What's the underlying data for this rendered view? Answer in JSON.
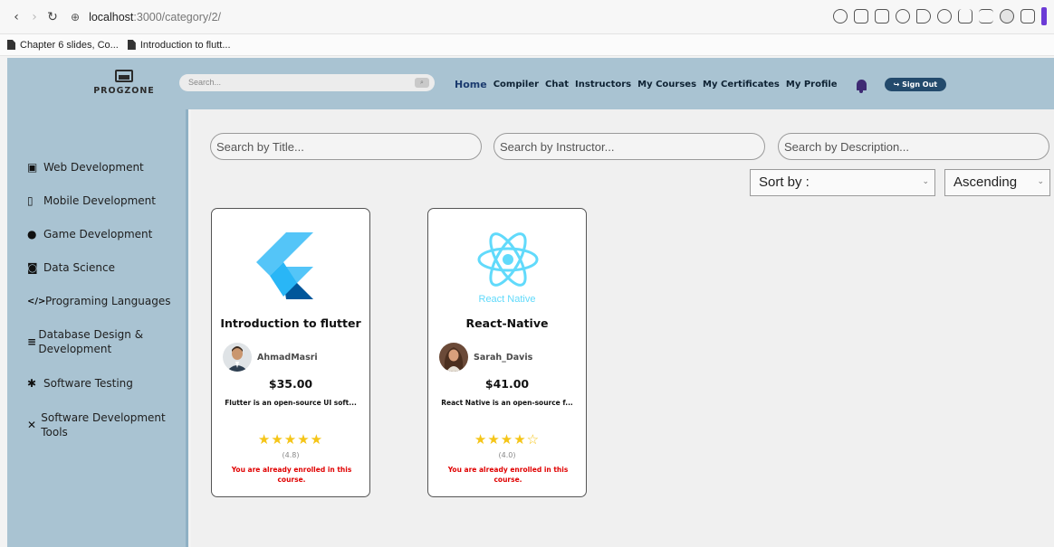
{
  "browser": {
    "url_host": "localhost",
    "url_path": ":3000/category/2/",
    "bookmarks": [
      "Chapter 6 slides, Co...",
      "Introduction to flutt..."
    ]
  },
  "header": {
    "logo_text": "PROGZONE",
    "search_placeholder": "Search...",
    "nav": [
      "Home",
      "Compiler",
      "Chat",
      "Instructors",
      "My Courses",
      "My Certificates",
      "My Profile"
    ],
    "sign_out": "Sign Out",
    "bell_icon": "bell-icon"
  },
  "sidebar": {
    "categories": [
      {
        "label": "Web Development",
        "icon": "laptop-icon"
      },
      {
        "label": "Mobile Development",
        "icon": "phone-icon"
      },
      {
        "label": "Game Development",
        "icon": "gamepad-icon"
      },
      {
        "label": "Data Science",
        "icon": "robot-icon"
      },
      {
        "label": "Programing Languages",
        "icon": "code-icon"
      },
      {
        "label": "Database Design & Development",
        "icon": "database-icon"
      },
      {
        "label": "Software Testing",
        "icon": "bug-icon"
      },
      {
        "label": "Software Development Tools",
        "icon": "tools-icon"
      }
    ]
  },
  "filters": {
    "title_placeholder": "Search by Title...",
    "instructor_placeholder": "Search by Instructor...",
    "description_placeholder": "Search by Description...",
    "sort_by": "Sort by :",
    "order": "Ascending"
  },
  "courses": [
    {
      "title": "Introduction to flutter",
      "instructor": "AhmadMasri",
      "price": "$35.00",
      "description": "Flutter is an open-source UI soft...",
      "stars": "★★★★★",
      "rating": "(4.8)",
      "status": "You are already enrolled in this course.",
      "logo_icon": "flutter-logo-icon",
      "colors": {
        "light": "#54c5f8",
        "dark": "#01579b"
      }
    },
    {
      "title": "React-Native",
      "instructor": "Sarah_Davis",
      "price": "$41.00",
      "description": "React Native is an open-source f...",
      "stars": "★★★★☆",
      "rating": "(4.0)",
      "status": "You are already enrolled in this course.",
      "logo_icon": "react-native-logo-icon",
      "logo_caption": "React Native",
      "colors": {
        "react": "#61dafb"
      }
    }
  ]
}
